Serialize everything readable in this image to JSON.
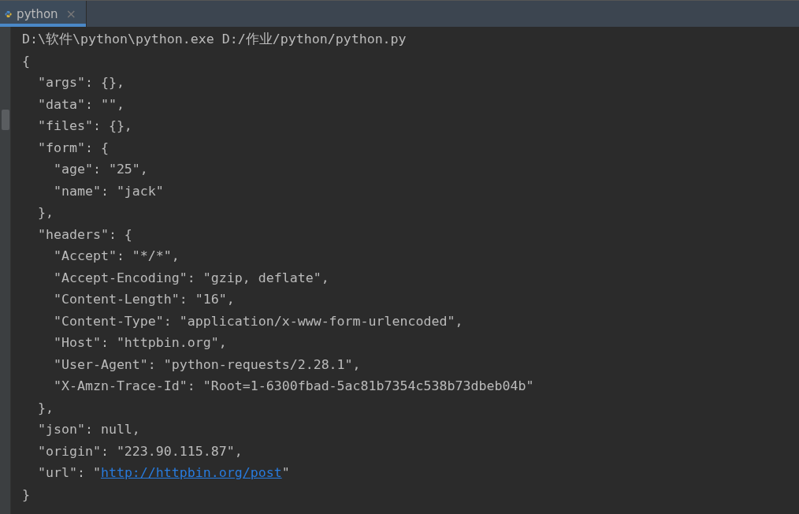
{
  "tabs": [
    {
      "label": "python",
      "selected": true,
      "close": "×"
    }
  ],
  "console": {
    "lines": [
      {
        "text": "D:\\软件\\python\\python.exe D:/作业/python/python.py"
      },
      {
        "text": "{"
      },
      {
        "text": "  \"args\": {},"
      },
      {
        "text": "  \"data\": \"\","
      },
      {
        "text": "  \"files\": {},"
      },
      {
        "text": "  \"form\": {"
      },
      {
        "text": "    \"age\": \"25\","
      },
      {
        "text": "    \"name\": \"jack\""
      },
      {
        "text": "  },"
      },
      {
        "text": "  \"headers\": {"
      },
      {
        "text": "    \"Accept\": \"*/*\","
      },
      {
        "text": "    \"Accept-Encoding\": \"gzip, deflate\","
      },
      {
        "text": "    \"Content-Length\": \"16\","
      },
      {
        "text": "    \"Content-Type\": \"application/x-www-form-urlencoded\","
      },
      {
        "text": "    \"Host\": \"httpbin.org\","
      },
      {
        "text": "    \"User-Agent\": \"python-requests/2.28.1\","
      },
      {
        "text": "    \"X-Amzn-Trace-Id\": \"Root=1-6300fbad-5ac81b7354c538b73dbeb04b\""
      },
      {
        "text": "  },"
      },
      {
        "text": "  \"json\": null,"
      },
      {
        "text": "  \"origin\": \"223.90.115.87\","
      },
      {
        "text": "  \"url\": \"",
        "link": "http://httpbin.org/post",
        "suffix": "\""
      },
      {
        "text": "}"
      }
    ]
  }
}
